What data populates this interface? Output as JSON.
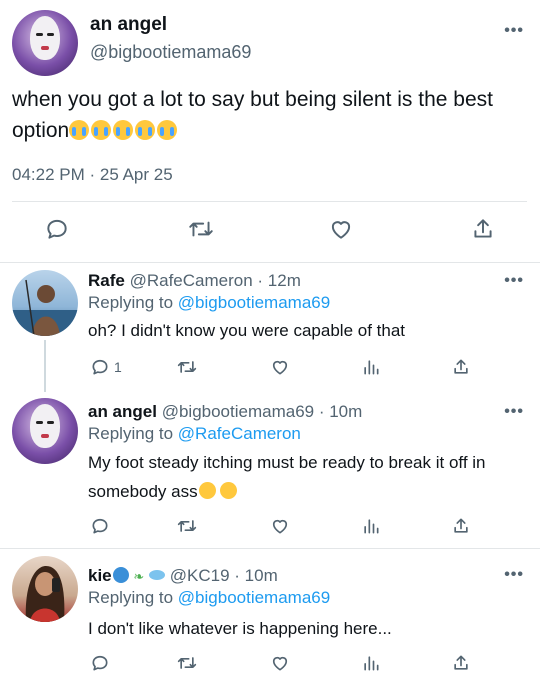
{
  "main_tweet": {
    "display_name": "an angel",
    "handle": "@bigbootiemama69",
    "text": "when you got a lot to say but being silent is the best option",
    "emoji_count": 5,
    "timestamp": "04:22 PM · 25 Apr 25",
    "more_label": "•••"
  },
  "replies": [
    {
      "display_name": "Rafe",
      "handle": "@RafeCameron",
      "age": "· 12m",
      "replying_label": "Replying to",
      "replying_to": "@bigbootiemama69",
      "text": "oh? I didn't know you were capable of that",
      "reply_count": "1",
      "more_label": "•••"
    },
    {
      "display_name": "an angel",
      "handle": "@bigbootiemama69",
      "age": "· 10m",
      "replying_label": "Replying to",
      "replying_to": "@RafeCameron",
      "text": "My foot steady itching must be ready to break it off in somebody ass",
      "more_label": "•••"
    },
    {
      "display_name": "kie",
      "handle": "@KC19",
      "age": "· 10m",
      "replying_label": "Replying to",
      "replying_to": "@bigbootiemama69",
      "text": "I don't like whatever is happening here...",
      "more_label": "•••"
    }
  ],
  "colors": {
    "text": "#0f1419",
    "secondary": "#536471",
    "link": "#1d9bf0",
    "divider": "#e3e6e8"
  },
  "icons": [
    "reply-icon",
    "retweet-icon",
    "like-icon",
    "views-icon",
    "share-icon",
    "more-icon"
  ]
}
